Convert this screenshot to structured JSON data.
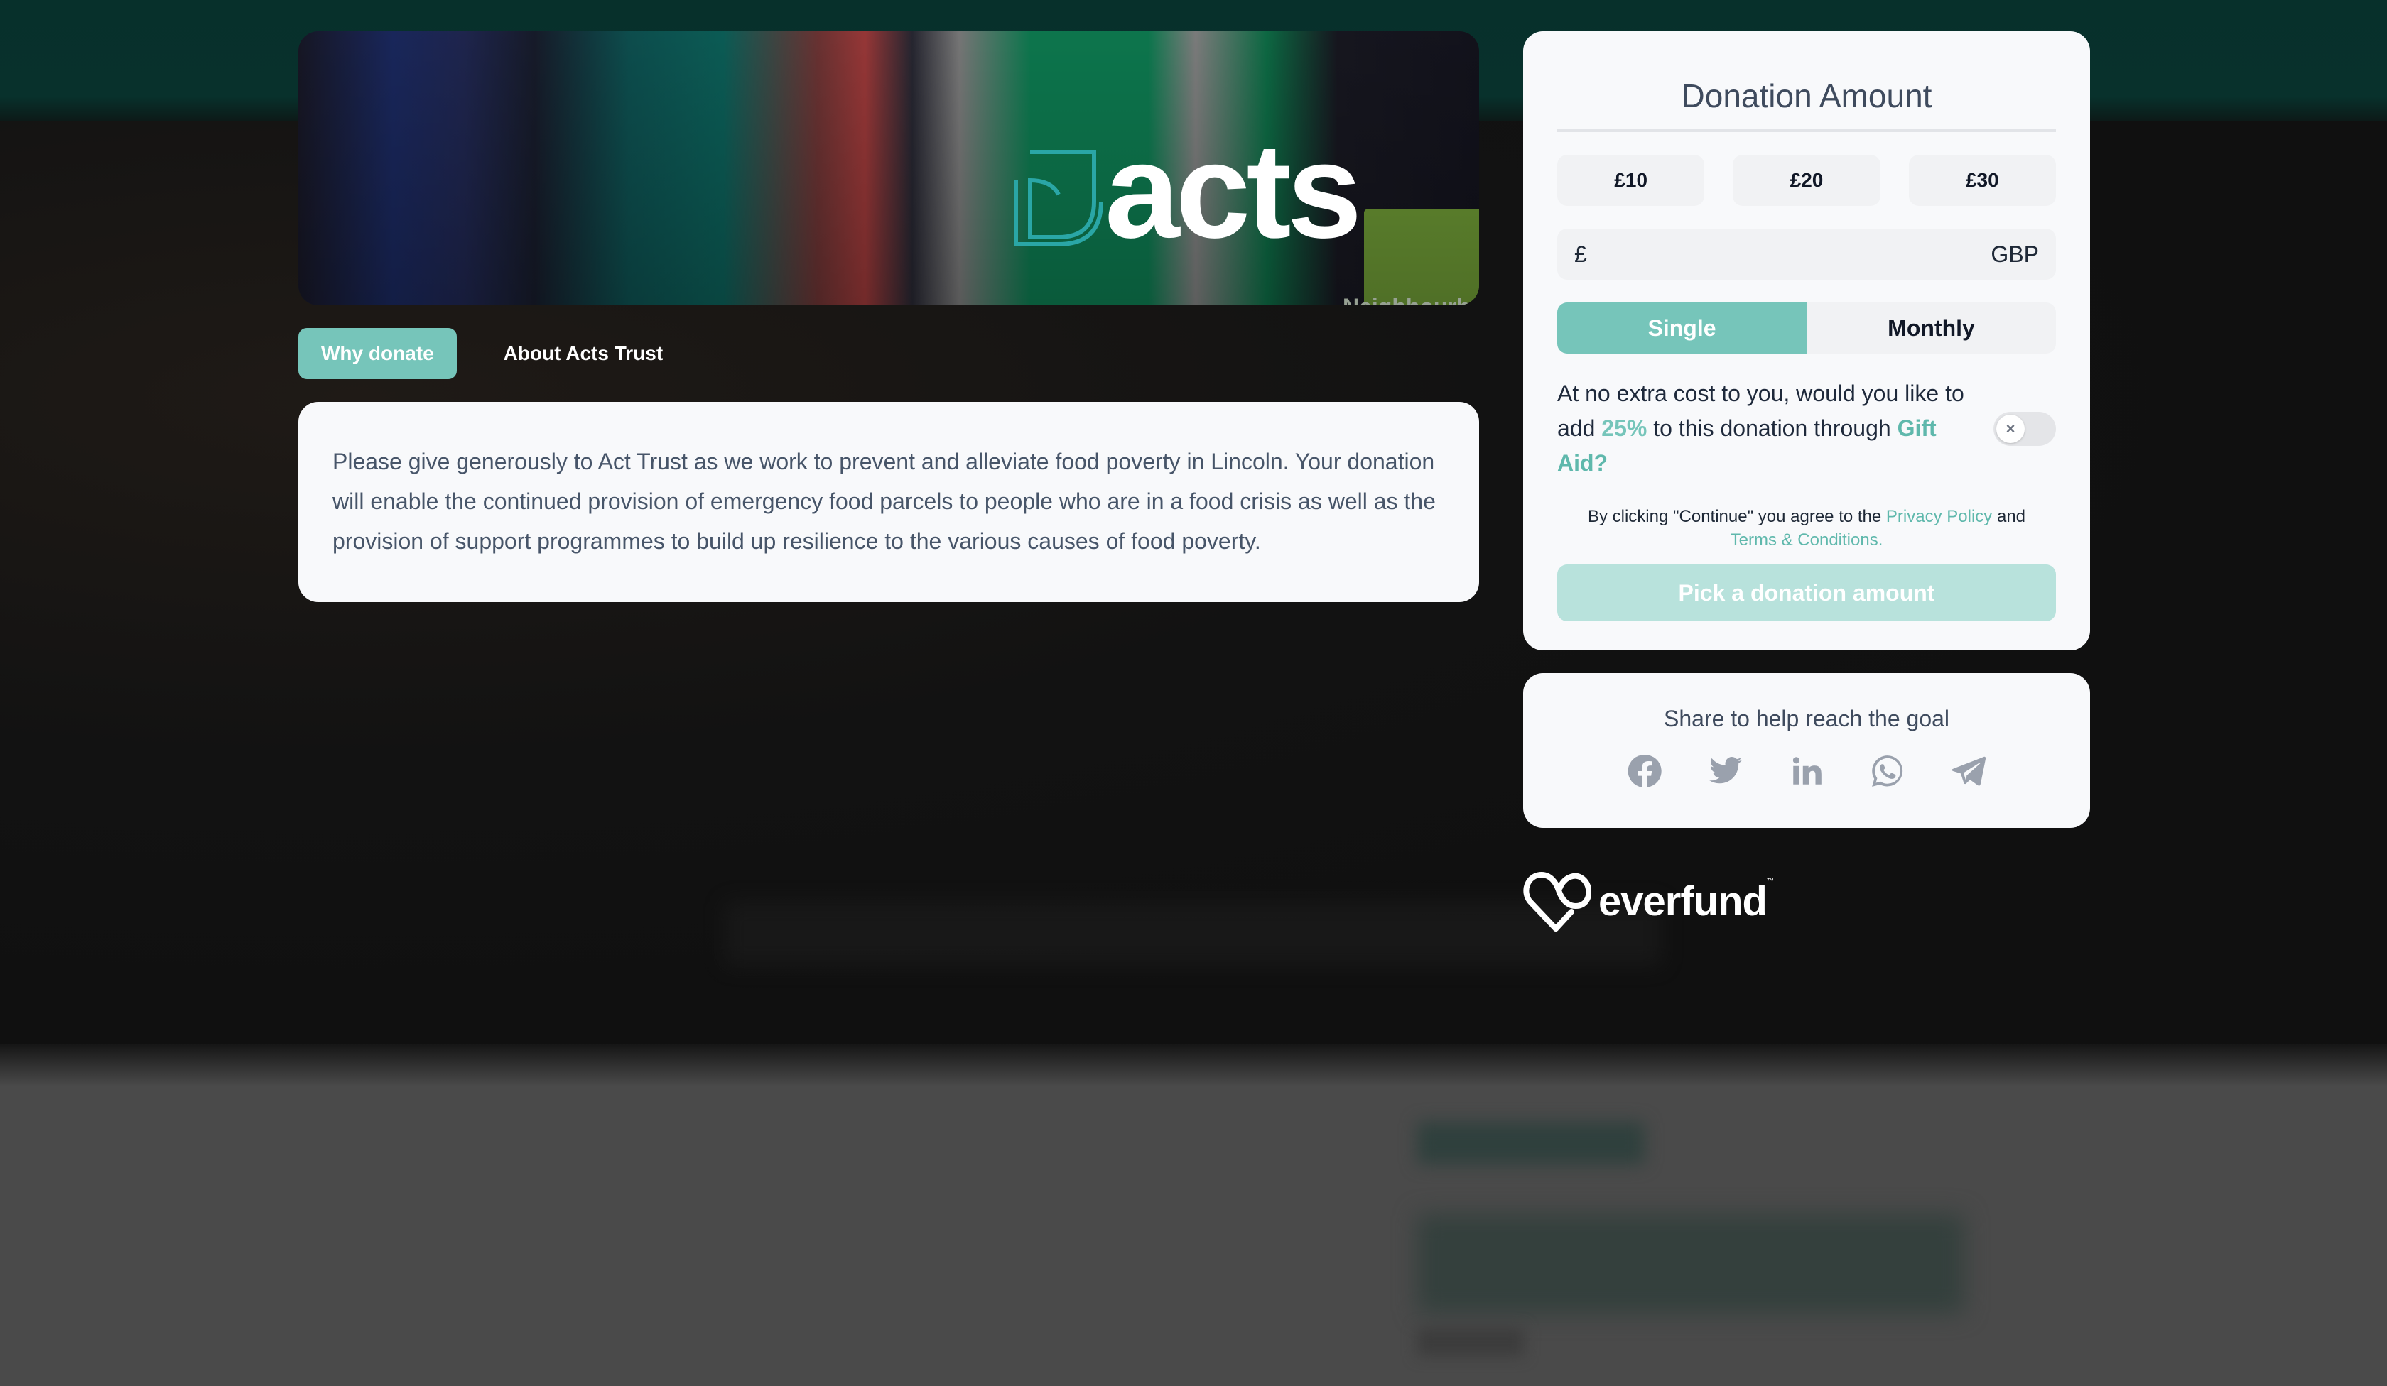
{
  "hero": {
    "brand": "acts",
    "badge_text": "Neighbourhood Food C..."
  },
  "tabs": [
    {
      "label": "Why donate",
      "active": true
    },
    {
      "label": "About Acts Trust",
      "active": false
    }
  ],
  "description": "Please give generously to Act Trust as we work to prevent and alleviate food poverty in Lincoln. Your donation will enable the continued provision of emergency food parcels to people who are in a food crisis as well as the provision of support programmes to build up resilience to the various causes of food poverty.",
  "donation": {
    "title": "Donation Amount",
    "amounts": [
      "£10",
      "£20",
      "£30"
    ],
    "input": {
      "currency_symbol": "£",
      "value": "",
      "placeholder": "",
      "currency_code": "GBP"
    },
    "frequency": [
      {
        "label": "Single",
        "active": true
      },
      {
        "label": "Monthly",
        "active": false
      }
    ],
    "gift_aid": {
      "text_before": "At no extra cost to you, would you like to add ",
      "percent": "25%",
      "text_middle": " to this donation through ",
      "link": "Gift Aid?",
      "enabled": false,
      "toggle_glyph": "×"
    },
    "terms": {
      "text_before": "By clicking \"Continue\" you agree to the ",
      "privacy_link": "Privacy Policy",
      "text_and": " and",
      "terms_link": "Terms & Conditions."
    },
    "cta_label": "Pick a donation amount"
  },
  "share": {
    "title": "Share to help reach the goal",
    "icons": [
      "facebook-icon",
      "twitter-icon",
      "linkedin-icon",
      "whatsapp-icon",
      "telegram-icon"
    ]
  },
  "footer": {
    "brand": "everfund",
    "tm": "™"
  },
  "colors": {
    "accent": "#76c5ba",
    "cta_disabled": "#b8e2dc",
    "card_bg": "#f8f9fb",
    "header_bg": "#07302b"
  }
}
